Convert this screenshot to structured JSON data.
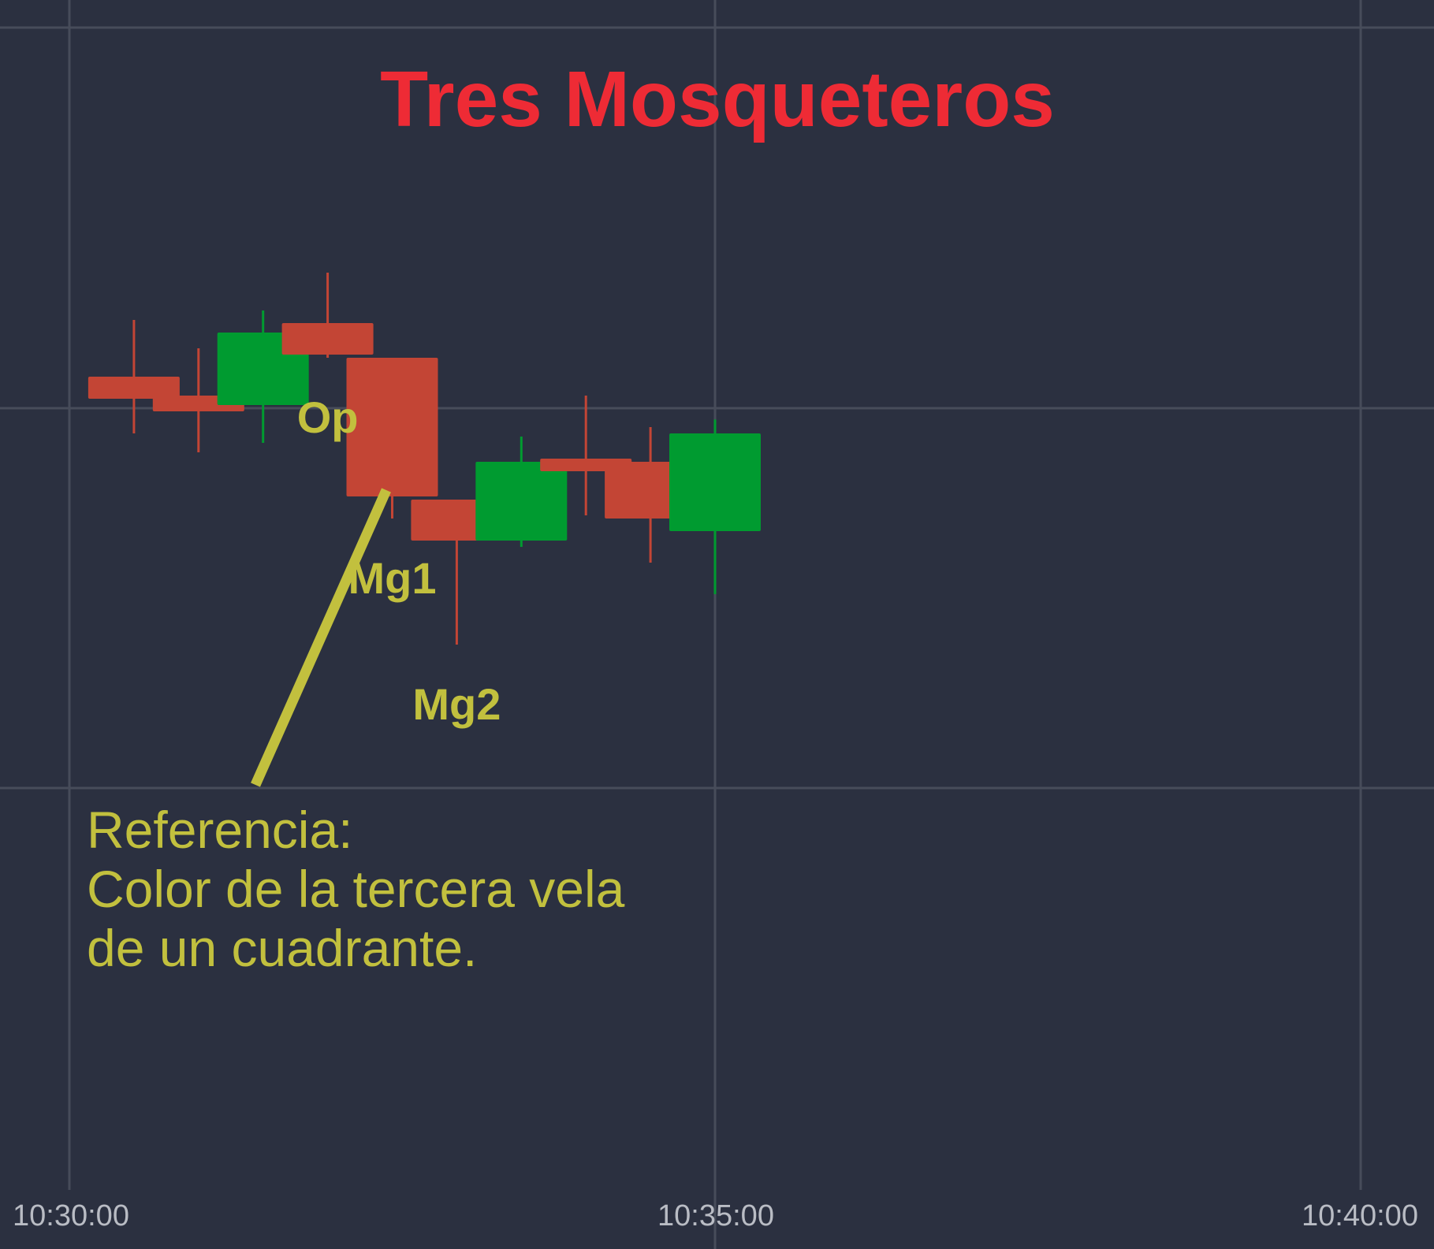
{
  "chart_data": {
    "type": "candlestick",
    "title": "Tres Mosqueteros",
    "x_ticks": [
      "10:30:00",
      "10:35:00",
      "10:40:00"
    ],
    "grid": true,
    "colors": {
      "bullish": "#009b30",
      "bearish": "#c34535",
      "background": "#2b3040",
      "grid": "#474c5a",
      "title": "#ee2b35",
      "annotation": "#c2c03e"
    },
    "candles": [
      {
        "time": "10:30:30",
        "open": 10.5,
        "close": 10.15,
        "high": 11.4,
        "low": 9.6
      },
      {
        "time": "10:31:00",
        "open": 10.2,
        "close": 9.95,
        "high": 10.95,
        "low": 9.3
      },
      {
        "time": "10:31:30",
        "open": 10.05,
        "close": 11.2,
        "high": 11.55,
        "low": 9.45
      },
      {
        "time": "10:32:00",
        "open": 11.35,
        "close": 10.85,
        "high": 12.15,
        "low": 10.8
      },
      {
        "time": "10:32:30",
        "open": 10.8,
        "close": 8.6,
        "high": 10.8,
        "low": 8.25
      },
      {
        "time": "10:33:00",
        "open": 8.55,
        "close": 7.9,
        "high": 8.55,
        "low": 6.25
      },
      {
        "time": "10:33:30",
        "open": 7.9,
        "close": 9.15,
        "high": 9.55,
        "low": 7.8
      },
      {
        "time": "10:34:00",
        "open": 9.2,
        "close": 9.0,
        "high": 10.2,
        "low": 8.3
      },
      {
        "time": "10:34:30",
        "open": 9.15,
        "close": 8.25,
        "high": 9.7,
        "low": 7.55
      },
      {
        "time": "10:35:00",
        "open": 8.05,
        "close": 9.6,
        "high": 9.82,
        "low": 7.05
      }
    ],
    "annotations": [
      {
        "text": "Op",
        "candle": 3
      },
      {
        "text": "Mg1",
        "candle": 4
      },
      {
        "text": "Mg2",
        "candle": 5
      }
    ],
    "note_lines": [
      "Referencia:",
      "Color de la tercera vela",
      "de un cuadrante."
    ]
  }
}
